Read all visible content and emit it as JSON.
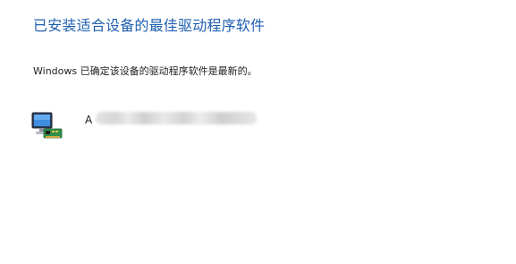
{
  "header": {
    "title": "已安装适合设备的最佳驱动程序软件"
  },
  "status": {
    "message": "Windows 已确定该设备的驱动程序软件是最新的。"
  },
  "device": {
    "icon": "monitor-with-adapter-card-icon",
    "name_visible_prefix": "A",
    "name_obscured": true
  },
  "colors": {
    "title": "#1f5fb0",
    "text": "#1e1e1e",
    "background": "#ffffff"
  }
}
